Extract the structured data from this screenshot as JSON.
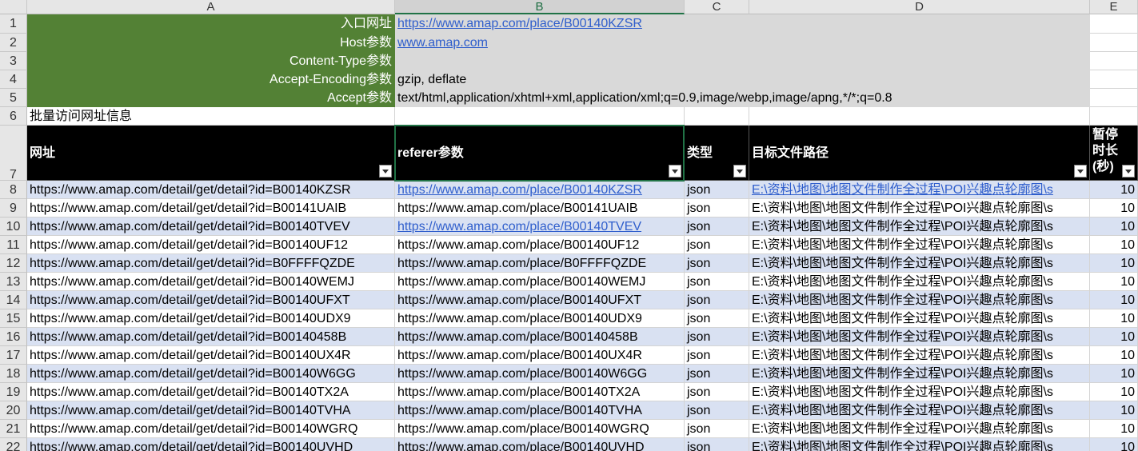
{
  "columns": [
    "A",
    "B",
    "C",
    "D",
    "E"
  ],
  "config": [
    {
      "label": "入口网址",
      "value": "https://www.amap.com/place/B00140KZSR",
      "link": true
    },
    {
      "label": "Host参数",
      "value": "www.amap.com",
      "link": true
    },
    {
      "label": "Content-Type参数",
      "value": "",
      "link": false
    },
    {
      "label": "Accept-Encoding参数",
      "value": "gzip, deflate",
      "link": false
    },
    {
      "label": "Accept参数",
      "value": "text/html,application/xhtml+xml,application/xml;q=0.9,image/webp,image/apng,*/*;q=0.8",
      "link": false
    }
  ],
  "section_title": "批量访问网址信息",
  "headers": [
    "网址",
    "referer参数",
    "类型",
    "目标文件路径",
    "暂停时长(秒)"
  ],
  "rows": [
    {
      "url": "https://www.amap.com/detail/get/detail?id=B00140KZSR",
      "referer": "https://www.amap.com/place/B00140KZSR",
      "type": "json",
      "path": "E:\\资料\\地图\\地图文件制作全过程\\POI兴趣点轮廓图\\s",
      "pause": "10",
      "ref_link": true,
      "path_link": true
    },
    {
      "url": "https://www.amap.com/detail/get/detail?id=B00141UAIB",
      "referer": "https://www.amap.com/place/B00141UAIB",
      "type": "json",
      "path": "E:\\资料\\地图\\地图文件制作全过程\\POI兴趣点轮廓图\\s",
      "pause": "10",
      "ref_link": false,
      "path_link": false
    },
    {
      "url": "https://www.amap.com/detail/get/detail?id=B00140TVEV",
      "referer": "https://www.amap.com/place/B00140TVEV",
      "type": "json",
      "path": "E:\\资料\\地图\\地图文件制作全过程\\POI兴趣点轮廓图\\s",
      "pause": "10",
      "ref_link": true,
      "path_link": false
    },
    {
      "url": "https://www.amap.com/detail/get/detail?id=B00140UF12",
      "referer": "https://www.amap.com/place/B00140UF12",
      "type": "json",
      "path": "E:\\资料\\地图\\地图文件制作全过程\\POI兴趣点轮廓图\\s",
      "pause": "10",
      "ref_link": false,
      "path_link": false
    },
    {
      "url": "https://www.amap.com/detail/get/detail?id=B0FFFFQZDE",
      "referer": "https://www.amap.com/place/B0FFFFQZDE",
      "type": "json",
      "path": "E:\\资料\\地图\\地图文件制作全过程\\POI兴趣点轮廓图\\s",
      "pause": "10",
      "ref_link": false,
      "path_link": false
    },
    {
      "url": "https://www.amap.com/detail/get/detail?id=B00140WEMJ",
      "referer": "https://www.amap.com/place/B00140WEMJ",
      "type": "json",
      "path": "E:\\资料\\地图\\地图文件制作全过程\\POI兴趣点轮廓图\\s",
      "pause": "10",
      "ref_link": false,
      "path_link": false
    },
    {
      "url": "https://www.amap.com/detail/get/detail?id=B00140UFXT",
      "referer": "https://www.amap.com/place/B00140UFXT",
      "type": "json",
      "path": "E:\\资料\\地图\\地图文件制作全过程\\POI兴趣点轮廓图\\s",
      "pause": "10",
      "ref_link": false,
      "path_link": false
    },
    {
      "url": "https://www.amap.com/detail/get/detail?id=B00140UDX9",
      "referer": "https://www.amap.com/place/B00140UDX9",
      "type": "json",
      "path": "E:\\资料\\地图\\地图文件制作全过程\\POI兴趣点轮廓图\\s",
      "pause": "10",
      "ref_link": false,
      "path_link": false
    },
    {
      "url": "https://www.amap.com/detail/get/detail?id=B00140458B",
      "referer": "https://www.amap.com/place/B00140458B",
      "type": "json",
      "path": "E:\\资料\\地图\\地图文件制作全过程\\POI兴趣点轮廓图\\s",
      "pause": "10",
      "ref_link": false,
      "path_link": false
    },
    {
      "url": "https://www.amap.com/detail/get/detail?id=B00140UX4R",
      "referer": "https://www.amap.com/place/B00140UX4R",
      "type": "json",
      "path": "E:\\资料\\地图\\地图文件制作全过程\\POI兴趣点轮廓图\\s",
      "pause": "10",
      "ref_link": false,
      "path_link": false
    },
    {
      "url": "https://www.amap.com/detail/get/detail?id=B00140W6GG",
      "referer": "https://www.amap.com/place/B00140W6GG",
      "type": "json",
      "path": "E:\\资料\\地图\\地图文件制作全过程\\POI兴趣点轮廓图\\s",
      "pause": "10",
      "ref_link": false,
      "path_link": false
    },
    {
      "url": "https://www.amap.com/detail/get/detail?id=B00140TX2A",
      "referer": "https://www.amap.com/place/B00140TX2A",
      "type": "json",
      "path": "E:\\资料\\地图\\地图文件制作全过程\\POI兴趣点轮廓图\\s",
      "pause": "10",
      "ref_link": false,
      "path_link": false
    },
    {
      "url": "https://www.amap.com/detail/get/detail?id=B00140TVHA",
      "referer": "https://www.amap.com/place/B00140TVHA",
      "type": "json",
      "path": "E:\\资料\\地图\\地图文件制作全过程\\POI兴趣点轮廓图\\s",
      "pause": "10",
      "ref_link": false,
      "path_link": false
    },
    {
      "url": "https://www.amap.com/detail/get/detail?id=B00140WGRQ",
      "referer": "https://www.amap.com/place/B00140WGRQ",
      "type": "json",
      "path": "E:\\资料\\地图\\地图文件制作全过程\\POI兴趣点轮廓图\\s",
      "pause": "10",
      "ref_link": false,
      "path_link": false
    },
    {
      "url": "https://www.amap.com/detail/get/detail?id=B00140UVHD",
      "referer": "https://www.amap.com/place/B00140UVHD",
      "type": "json",
      "path": "E:\\资料\\地图\\地图文件制作全过程\\POI兴趣点轮廓图\\s",
      "pause": "10",
      "ref_link": false,
      "path_link": false
    }
  ],
  "colors": {
    "green": "#538135",
    "gray": "#d9d9d9",
    "band": "#d9e1f2",
    "header_bg": "#000000",
    "link": "#2f5ecc",
    "selection": "#217346"
  },
  "selected_column": "B"
}
